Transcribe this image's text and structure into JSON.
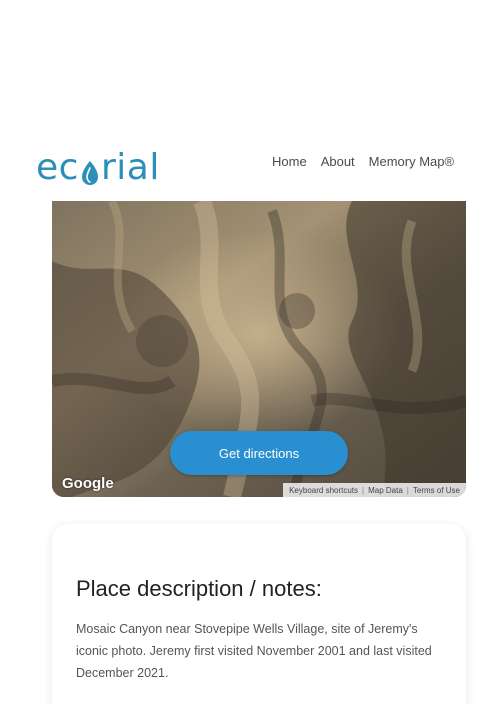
{
  "header": {
    "logo_prefix": "ec",
    "logo_suffix": "rial",
    "nav": [
      {
        "label": "Home"
      },
      {
        "label": "About"
      },
      {
        "label": "Memory Map®"
      }
    ]
  },
  "map": {
    "directions_label": "Get directions",
    "provider_logo": "Google",
    "footer": {
      "shortcuts": "Keyboard shortcuts",
      "map_data": "Map Data",
      "terms": "Terms of Use"
    }
  },
  "notes": {
    "title": "Place description / notes:",
    "body": "Mosaic Canyon near Stovepipe Wells Village, site of Jeremy's iconic photo. Jeremy first visited November 2001 and last visited December 2021."
  },
  "colors": {
    "brand": "#2b8fb8",
    "button": "#2a8fd0",
    "text": "#222222",
    "muted_text": "#555555"
  },
  "icons": {
    "logo_mark": "leaf-drop-icon"
  }
}
